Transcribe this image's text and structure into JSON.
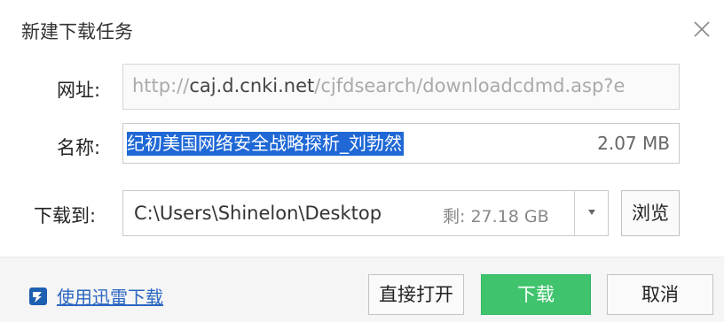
{
  "dialog": {
    "title": "新建下载任务"
  },
  "url": {
    "label": "网址:",
    "prefix": "http://",
    "host": "caj.d.cnki.net",
    "rest": "/cjfdsearch/downloadcdmd.asp?e"
  },
  "name": {
    "label": "名称:",
    "selected_value": "纪初美国网络安全战略探析_刘勃然",
    "size": "2.07 MB"
  },
  "save_to": {
    "label": "下载到:",
    "path": "C:\\Users\\Shinelon\\Desktop",
    "free_space": "剩: 27.18 GB",
    "browse_label": "浏览"
  },
  "footer": {
    "thunder_link": "使用迅雷下载",
    "direct_open_label": "直接打开",
    "download_label": "下载",
    "cancel_label": "取消"
  },
  "colors": {
    "accent_green": "#3fc46d",
    "selection_blue": "#1f68d6",
    "link_blue": "#2b66c1"
  }
}
